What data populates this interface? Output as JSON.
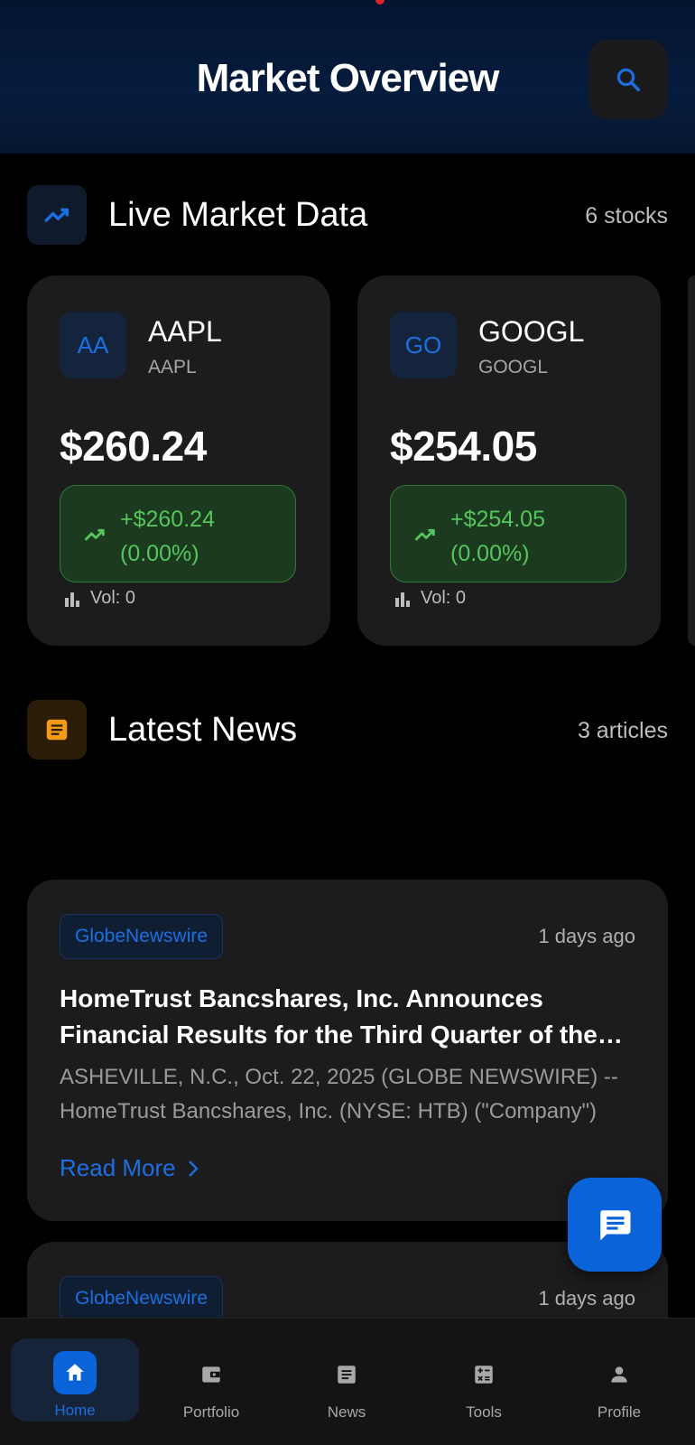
{
  "header": {
    "title": "Market Overview"
  },
  "market": {
    "title": "Live Market Data",
    "count": "6 stocks",
    "stocks": [
      {
        "avatar": "AA",
        "symbol": "AAPL",
        "name": "AAPL",
        "price": "$260.24",
        "change": "+$260.24",
        "change_pct": "(0.00%)",
        "volume": "Vol: 0"
      },
      {
        "avatar": "GO",
        "symbol": "GOOGL",
        "name": "GOOGL",
        "price": "$254.05",
        "change": "+$254.05",
        "change_pct": "(0.00%)",
        "volume": "Vol: 0"
      }
    ]
  },
  "news": {
    "title": "Latest News",
    "count": "3 articles",
    "articles": [
      {
        "source": "GlobeNewswire",
        "time": "1 days ago",
        "title": "HomeTrust Bancshares, Inc. Announces Financial Results for the Third Quarter of the Fiscal Year",
        "excerpt": "ASHEVILLE, N.C., Oct. 22, 2025 (GLOBE NEWSWIRE) -- HomeTrust Bancshares, Inc. (NYSE: HTB) (\"Company\")",
        "read_more": "Read More"
      },
      {
        "source": "GlobeNewswire",
        "time": "1 days ago"
      }
    ]
  },
  "nav": {
    "items": [
      {
        "label": "Home",
        "icon": "home-icon",
        "active": true
      },
      {
        "label": "Portfolio",
        "icon": "wallet-icon"
      },
      {
        "label": "News",
        "icon": "article-icon"
      },
      {
        "label": "Tools",
        "icon": "calculator-icon"
      },
      {
        "label": "Profile",
        "icon": "person-icon"
      }
    ]
  },
  "colors": {
    "accent": "#1c6fe0",
    "positive": "#55c55c",
    "news_icon": "#f29a16",
    "card": "#1c1c1e"
  }
}
